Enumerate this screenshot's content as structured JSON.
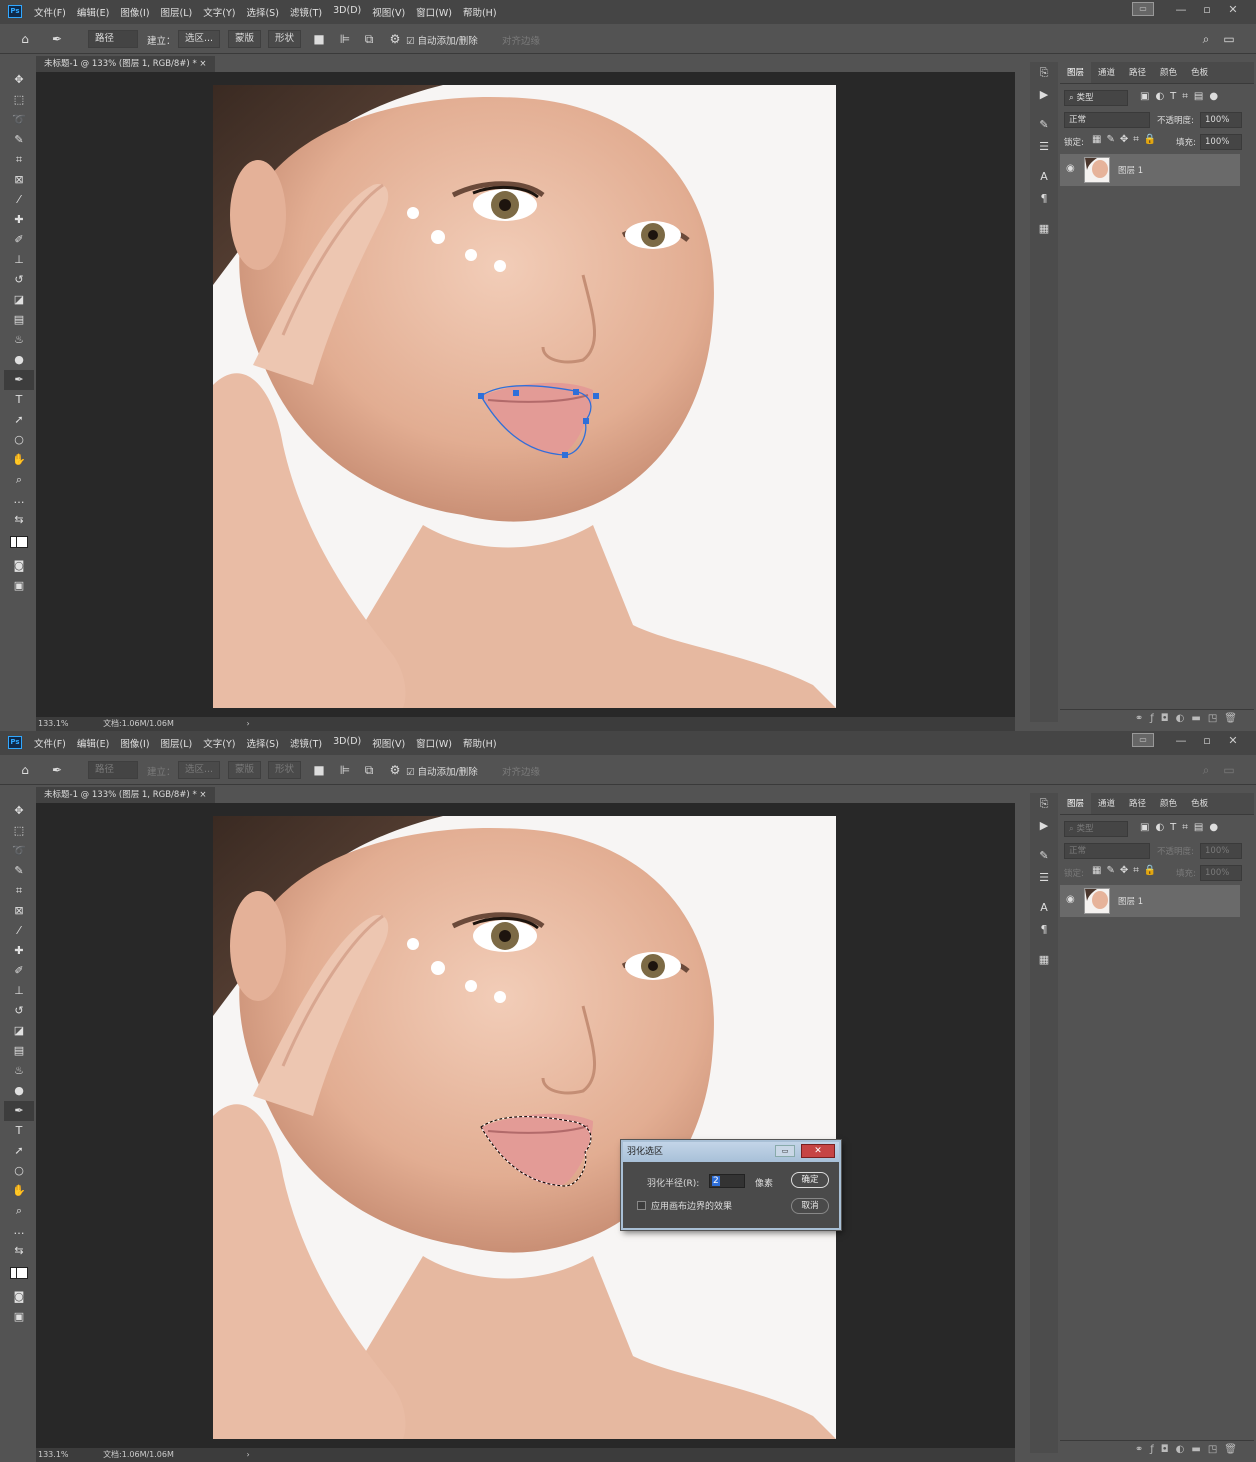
{
  "menu": [
    "文件(F)",
    "编辑(E)",
    "图像(I)",
    "图层(L)",
    "文字(Y)",
    "选择(S)",
    "滤镜(T)",
    "3D(D)",
    "视图(V)",
    "窗口(W)",
    "帮助(H)"
  ],
  "ps_logo": "Ps",
  "window_controls": {
    "minimize": "—",
    "restore": "▫",
    "close": "✕"
  },
  "options": {
    "path_mode": "路径",
    "make_label": "建立：",
    "selection_btn": "选区...",
    "mask_btn": "蒙版",
    "shape_btn": "形状",
    "auto_add": "自动添加/删除",
    "align_edges": "对齐边缘"
  },
  "doc_tab": "未标题-1 @ 133% (图层 1, RGB/8#) *",
  "doc_tab_close": "×",
  "status": {
    "zoom": "133.1%",
    "doc": "文档:1.06M/1.06M",
    "arrow": "›"
  },
  "panel": {
    "tabs": [
      "图层",
      "通道",
      "路径",
      "颜色",
      "色板"
    ],
    "filter": "类型",
    "blend": "正常",
    "opacity_label": "不透明度:",
    "opacity": "100%",
    "lock_label": "锁定:",
    "fill_label": "填充:",
    "fill": "100%",
    "layer_name": "图层 1"
  },
  "dialog": {
    "title": "羽化选区",
    "radius_label": "羽化半径(R):",
    "radius_value": "2",
    "unit": "像素",
    "ok": "确定",
    "cancel": "取消",
    "apply_label": "应用画布边界的效果"
  },
  "colors": {
    "path": "#2f6fd9",
    "ui_bg": "#535353",
    "canvas_bg": "#282828"
  }
}
